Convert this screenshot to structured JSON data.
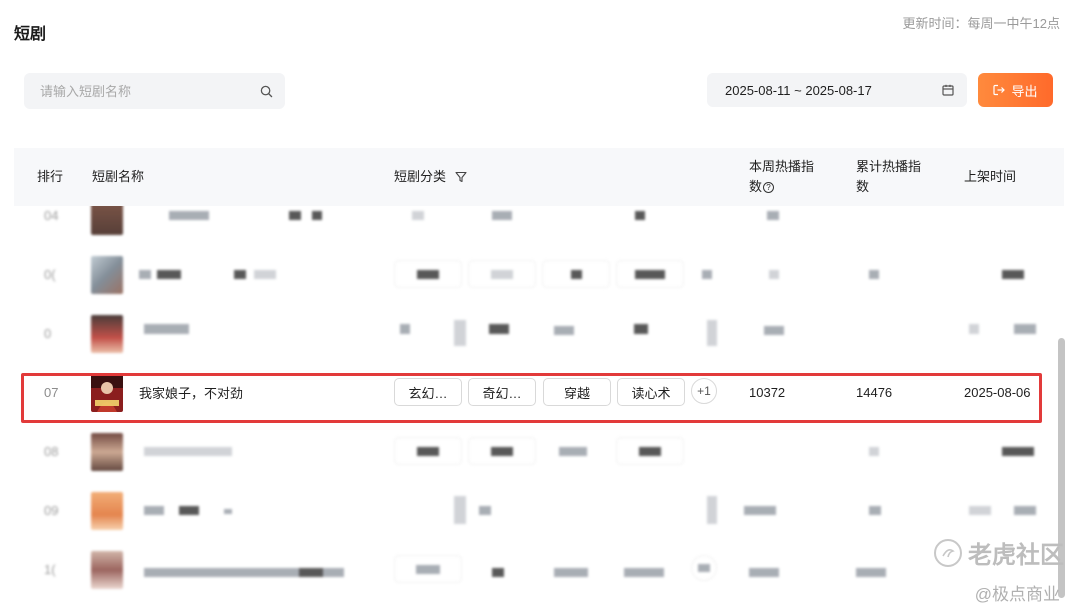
{
  "page": {
    "title": "短剧",
    "update_time": "更新时间：每周一中午12点"
  },
  "search": {
    "placeholder": "请输入短剧名称"
  },
  "date_range": {
    "value": "2025-08-11 ~ 2025-08-17"
  },
  "export": {
    "label": "导出"
  },
  "table": {
    "headers": {
      "rank": "排行",
      "name": "短剧名称",
      "category": "短剧分类",
      "weekly_heat_line1": "本周热播指",
      "weekly_heat_line2": "数",
      "total_heat_line1": "累计热播指",
      "total_heat_line2": "数",
      "release_date": "上架时间"
    },
    "highlighted_row": {
      "rank": "07",
      "name": "我家娘子，不对劲",
      "tags": [
        "玄幻…",
        "奇幻…",
        "穿越",
        "读心术"
      ],
      "more": "+1",
      "weekly_heat": "10372",
      "total_heat": "14476",
      "release_date": "2025-08-06"
    },
    "blurred_ranks": [
      "04",
      "0(",
      "0",
      "08",
      "09",
      "1("
    ]
  },
  "watermark": {
    "main": "老虎社区",
    "sub": "@极点商业"
  }
}
